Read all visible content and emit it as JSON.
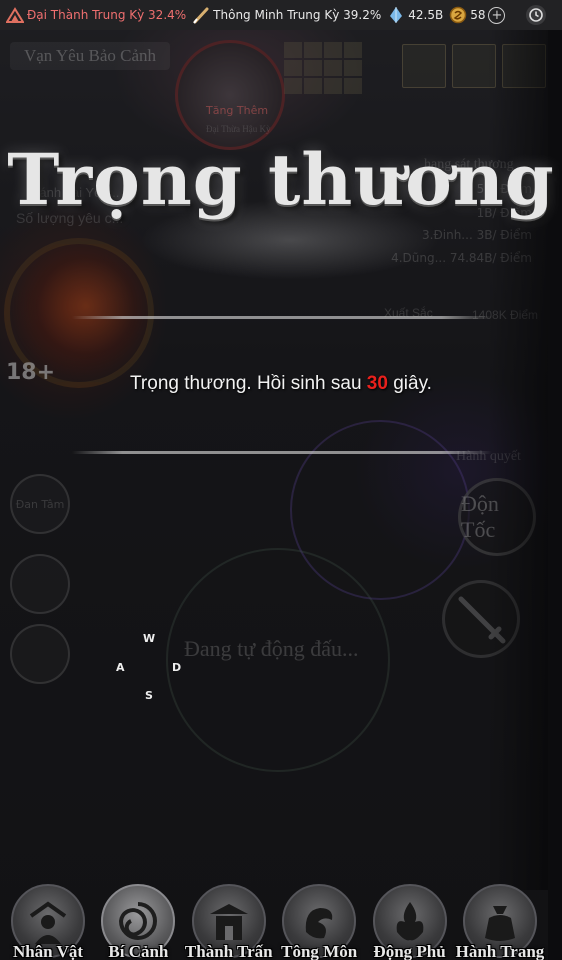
{
  "status_bar": {
    "realm_stat": "Đại Thành Trung Kỳ 32.4%",
    "intellect_stat": "Thông Minh Trung Kỳ 39.2%",
    "spirit_stones": "42.5B",
    "gold": "58",
    "plus_label": "+"
  },
  "background": {
    "region_title": "Vạn Yêu Bảo Cảnh",
    "boss_effect": "Tăng Thêm",
    "boss_sub": "Đại Thừa Hậu Kỳ",
    "left_info_1": "Đánh bại Yêu...",
    "left_info_2": "Số lượng yêu c...",
    "ranking_header": "hạng sát thương",
    "ranking_rows": [
      "5B/ Điểm",
      "1B/ Điểm",
      "3.Đinh...   3B/ Điểm",
      "4.Dũng...   74.84B/ Điểm"
    ],
    "excellent_label": "Xuất Sắc",
    "excellent_value": "1408K Điểm",
    "skill_label": "Hành quyết",
    "level_badge": "18+",
    "dan_tam": "Đan Tâm",
    "auto_fight": "Đang tự động đấu...",
    "don_toc": "Độn Tốc"
  },
  "keys": {
    "w": "W",
    "a": "A",
    "s": "S",
    "d": "D"
  },
  "dialog": {
    "title": "Trọng thương",
    "message_prefix": "Trọng thương. Hồi sinh sau ",
    "seconds": "30",
    "message_suffix": " giây."
  },
  "bottom_nav": {
    "items": [
      {
        "label": "Nhân Vật",
        "icon": "character-icon"
      },
      {
        "label": "Bí Cảnh",
        "icon": "secret-realm-icon"
      },
      {
        "label": "Thành Trấn",
        "icon": "town-icon"
      },
      {
        "label": "Tông Môn",
        "icon": "sect-icon"
      },
      {
        "label": "Động Phủ",
        "icon": "cave-icon"
      },
      {
        "label": "Hành Trang",
        "icon": "bag-icon"
      }
    ],
    "active_index": 1
  },
  "colors": {
    "accent_red": "#e8201c",
    "realm_text": "#ef6f6f"
  }
}
